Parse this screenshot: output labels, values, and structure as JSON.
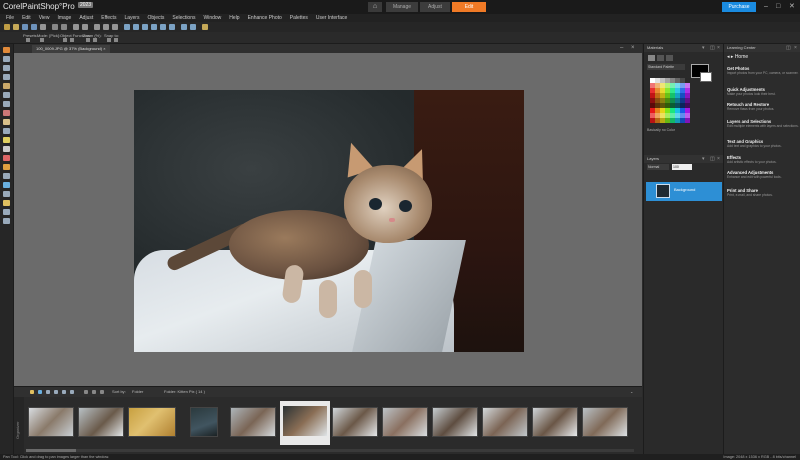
{
  "app": {
    "brand_prefix": "Corel",
    "brand_name": "PaintShop",
    "brand_suffix": "Pro",
    "version": "2023"
  },
  "workspace_tabs": {
    "manage": "Manage",
    "adjust": "Adjust",
    "edit": "Edit"
  },
  "purchase_label": "Purchase",
  "window_controls": {
    "minimize": "–",
    "maximize": "□",
    "close": "✕"
  },
  "menu": [
    "File",
    "Edit",
    "View",
    "Image",
    "Adjust",
    "Effects",
    "Layers",
    "Objects",
    "Selections",
    "Window",
    "Help",
    "Enhance Photo",
    "Palettes",
    "User Interface"
  ],
  "tool_options": {
    "presets_label": "Presets:",
    "mode_label": "Mode: [Pick]:",
    "object_label": "Object Functions:",
    "zoom_label": "Zoom (%):",
    "snap_label": "Snap to:"
  },
  "document_tab": {
    "title": "100_0009.JPG @ 37% (Background)",
    "close": "×"
  },
  "organizer": {
    "side_label": "Organizer",
    "sort_label": "Sort by:",
    "sort_value": "Folder",
    "folder_label": "Folder: Kitten Pix ( 14 )"
  },
  "materials": {
    "title": "Materials",
    "palette_select": "Standard Palette",
    "note": "Basically no Color"
  },
  "layers": {
    "title": "Layers",
    "blend_mode": "Normal",
    "opacity": "100",
    "layer_name": "Background"
  },
  "learning": {
    "title": "Learning Center",
    "home_label": "Home",
    "items": [
      {
        "title": "Get Photos",
        "desc": "Import photos from your PC, camera, or scanner."
      },
      {
        "title": "Quick Adjustments",
        "desc": "Make your photos look their best."
      },
      {
        "title": "Retouch and Restore",
        "desc": "Remove flaws from your photos."
      },
      {
        "title": "Layers and Selections",
        "desc": "Edit multiple elements with layers and selections."
      },
      {
        "title": "Text and Graphics",
        "desc": "Add text and graphics to your photos."
      },
      {
        "title": "Effects",
        "desc": "Add artistic effects to your photos."
      },
      {
        "title": "Advanced Adjustments",
        "desc": "Enhance and edit with powerful tools."
      },
      {
        "title": "Print and Share",
        "desc": "Print, e-mail, and share photos."
      }
    ]
  },
  "status": {
    "left": "Pan Tool: Click and drag to pan images larger than the window.",
    "right": "Image: 2048 x 1536 x RGB - 8 bits/channel"
  },
  "colors": {
    "accent_orange": "#f07a26",
    "purchase_blue": "#1a8be0",
    "selection_blue": "#2d8fd5",
    "canvas_gray": "#6b6b6b"
  }
}
